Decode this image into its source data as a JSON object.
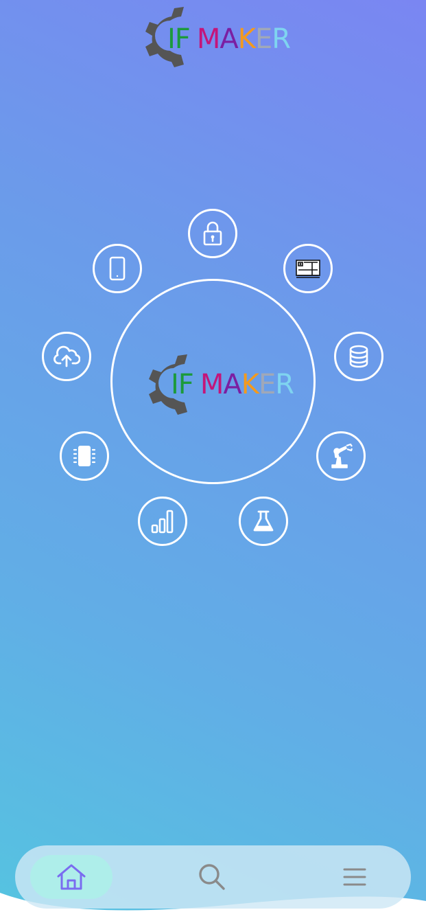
{
  "brand": {
    "logo_letters": [
      {
        "char": "I",
        "color": "#1c9a3c"
      },
      {
        "char": "F",
        "color": "#1c9a3c"
      },
      {
        "char": "M",
        "color": "#c4157a"
      },
      {
        "char": "A",
        "color": "#7b1fa2"
      },
      {
        "char": "K",
        "color": "#f39a1e"
      },
      {
        "char": "E",
        "color": "#a0a8b8"
      },
      {
        "char": "R",
        "color": "#7fd4f0"
      }
    ],
    "gear_color": "#555555"
  },
  "ring": {
    "items": [
      {
        "id": "lock",
        "icon": "lock-icon"
      },
      {
        "id": "printer",
        "icon": "printer-3d-icon"
      },
      {
        "id": "database",
        "icon": "database-icon"
      },
      {
        "id": "robot-arm",
        "icon": "robot-arm-icon"
      },
      {
        "id": "flask",
        "icon": "flask-icon"
      },
      {
        "id": "signal",
        "icon": "signal-bars-icon"
      },
      {
        "id": "chip",
        "icon": "chip-icon"
      },
      {
        "id": "cloud-upload",
        "icon": "cloud-upload-icon"
      },
      {
        "id": "mobile",
        "icon": "mobile-icon"
      }
    ]
  },
  "bottom_nav": {
    "items": [
      {
        "id": "home",
        "icon": "home-icon",
        "active": true
      },
      {
        "id": "search",
        "icon": "search-icon",
        "active": false
      },
      {
        "id": "menu",
        "icon": "hamburger-menu-icon",
        "active": false
      }
    ],
    "active_color": "#7a6cf0",
    "inactive_color": "#8a8a8a"
  }
}
